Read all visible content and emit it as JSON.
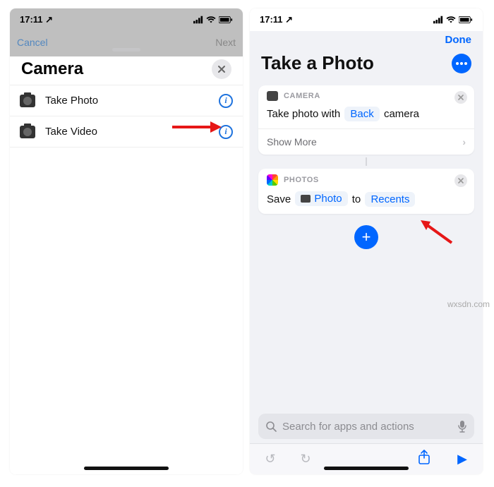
{
  "status": {
    "time": "17:11",
    "loc_glyph": "↗"
  },
  "left": {
    "back_hint": "Cancel",
    "next_hint": "Next",
    "sheet_title": "Camera",
    "rows": [
      {
        "label": "Take Photo"
      },
      {
        "label": "Take Video"
      }
    ]
  },
  "right": {
    "done": "Done",
    "title": "Take a Photo",
    "card_camera": {
      "app": "CAMERA",
      "pre": "Take photo with",
      "param": "Back",
      "post": "camera",
      "show_more": "Show More"
    },
    "card_photos": {
      "app": "PHOTOS",
      "pre": "Save",
      "param1": "Photo",
      "mid": "to",
      "param2": "Recents"
    },
    "search_placeholder": "Search for apps and actions"
  },
  "watermark": "wxsdn.com"
}
